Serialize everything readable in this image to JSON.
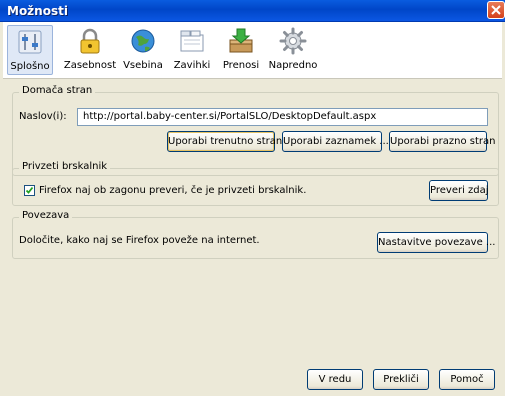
{
  "window": {
    "title": "Možnosti"
  },
  "toolbar": {
    "items": [
      {
        "label": "Splošno",
        "icon": "general-sliders-icon",
        "selected": true
      },
      {
        "label": "Zasebnost",
        "icon": "lock-icon"
      },
      {
        "label": "Vsebina",
        "icon": "globe-icon"
      },
      {
        "label": "Zavihki",
        "icon": "tabs-icon"
      },
      {
        "label": "Prenosi",
        "icon": "downloads-icon"
      },
      {
        "label": "Napredno",
        "icon": "gear-icon"
      }
    ]
  },
  "home": {
    "group_title": "Domača stran",
    "address_label": "Naslov(i):",
    "address_value": "http://portal.baby-center.si/PortalSLO/DesktopDefault.aspx",
    "btn_current": "Uporabi trenutno stran",
    "btn_bookmark": "Uporabi zaznamek ...",
    "btn_blank": "Uporabi prazno stran"
  },
  "default_browser": {
    "group_title": "Privzeti brskalnik",
    "checkbox_label": "Firefox naj ob zagonu preveri, če je privzeti brskalnik.",
    "checked": true,
    "btn_check": "Preveri zdaj"
  },
  "connection": {
    "group_title": "Povezava",
    "description": "Določite, kako naj se Firefox poveže na internet.",
    "btn_settings": "Nastavitve povezave ..."
  },
  "footer": {
    "ok": "V redu",
    "cancel": "Prekliči",
    "help": "Pomoč"
  }
}
